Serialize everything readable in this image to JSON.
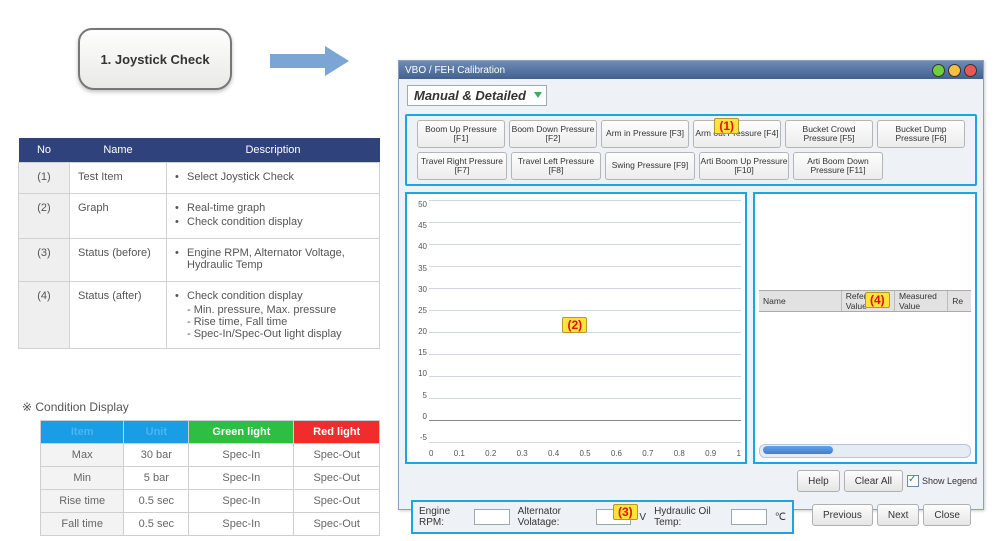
{
  "joystick_box": "1. Joystick Check",
  "desc_table": {
    "headers": [
      "No",
      "Name",
      "Description"
    ],
    "rows": [
      {
        "no": "(1)",
        "name": "Test Item",
        "desc": [
          "Select Joystick Check"
        ]
      },
      {
        "no": "(2)",
        "name": "Graph",
        "desc": [
          "Real-time graph",
          "Check condition display"
        ]
      },
      {
        "no": "(3)",
        "name": "Status (before)",
        "desc": [
          "Engine RPM, Alternator Voltage, Hydraulic Temp"
        ]
      },
      {
        "no": "(4)",
        "name": "Status (after)",
        "desc": [
          "Check condition display",
          "- Min. pressure, Max. pressure",
          "- Rise time, Fall time",
          "- Spec-In/Spec-Out light display"
        ]
      }
    ]
  },
  "condition_label": "※ Condition Display",
  "cond_table": {
    "headers": [
      "Item",
      "Unit",
      "Green light",
      "Red light"
    ],
    "rows": [
      [
        "Max",
        "30 bar",
        "Spec-In",
        "Spec-Out"
      ],
      [
        "Min",
        "5 bar",
        "Spec-In",
        "Spec-Out"
      ],
      [
        "Rise time",
        "0.5 sec",
        "Spec-In",
        "Spec-Out"
      ],
      [
        "Fall time",
        "0.5 sec",
        "Spec-In",
        "Spec-Out"
      ]
    ]
  },
  "app": {
    "title": "VBO / FEH Calibration",
    "selector": "Manual & Detailed",
    "buttons_row1": [
      "Boom Up Pressure [F1]",
      "Boom Down Pressure [F2]",
      "Arm in Pressure [F3]",
      "Arm out Pressure [F4]",
      "Bucket Crowd Pressure [F5]",
      "Bucket Dump Pressure [F6]"
    ],
    "buttons_row2": [
      "Travel Right Pressure [F7]",
      "Travel Left Pressure [F8]",
      "Swing Pressure [F9]",
      "Arti Boom Up Pressure [F10]",
      "Arti Boom Down Pressure [F11]"
    ],
    "yticks": [
      "50",
      "45",
      "40",
      "35",
      "30",
      "25",
      "20",
      "15",
      "10",
      "5",
      "0",
      "-5"
    ],
    "xticks": [
      "0",
      "0.1",
      "0.2",
      "0.3",
      "0.4",
      "0.5",
      "0.6",
      "0.7",
      "0.8",
      "0.9",
      "1"
    ],
    "table_headers": [
      "Name",
      "Reference Value",
      "Measured Value",
      "Re"
    ],
    "help": "Help",
    "clear": "Clear All",
    "show_legend": "Show Legend",
    "status": {
      "rpm_label": "Engine RPM:",
      "alt_label": "Alternator Volatage:",
      "alt_unit": "V",
      "hyd_label": "Hydraulic Oil Temp:",
      "hyd_unit": "℃"
    },
    "nav": {
      "prev": "Previous",
      "next": "Next",
      "close": "Close"
    },
    "tags": {
      "1": "(1)",
      "2": "(2)",
      "3": "(3)",
      "4": "(4)"
    }
  },
  "chart_data": {
    "type": "line",
    "title": "",
    "xlabel": "",
    "ylabel": "",
    "xlim": [
      0,
      1
    ],
    "ylim": [
      -5,
      50
    ],
    "x_ticks": [
      0,
      0.1,
      0.2,
      0.3,
      0.4,
      0.5,
      0.6,
      0.7,
      0.8,
      0.9,
      1
    ],
    "y_ticks": [
      -5,
      0,
      5,
      10,
      15,
      20,
      25,
      30,
      35,
      40,
      45,
      50
    ],
    "series": []
  }
}
